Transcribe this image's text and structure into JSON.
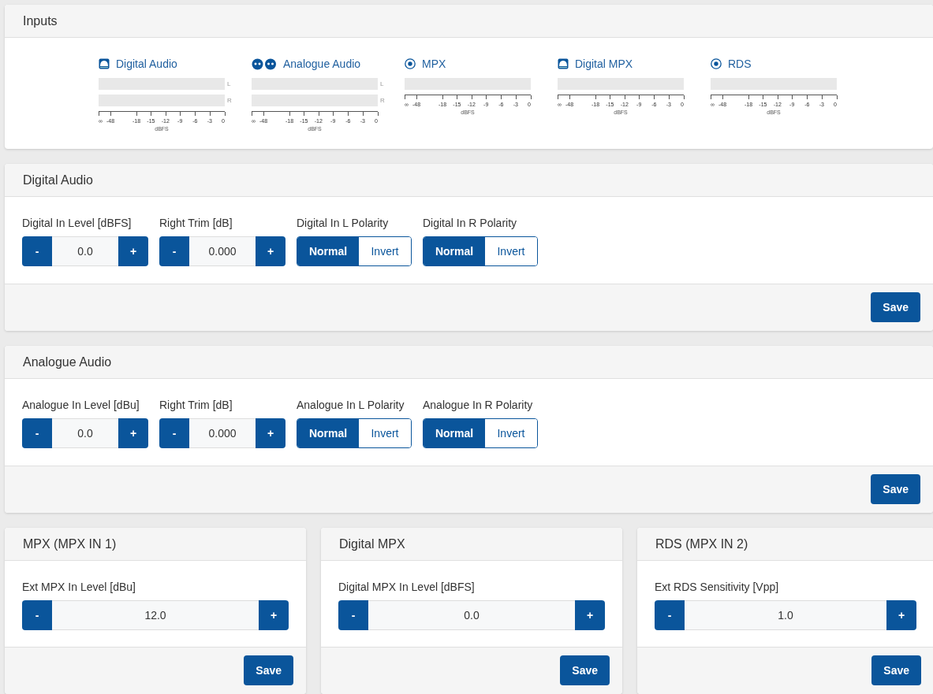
{
  "inputs": {
    "title": "Inputs",
    "meters": [
      {
        "kind": "digital",
        "label": "Digital Audio",
        "channels": [
          {
            "label": "L",
            "level": 0
          },
          {
            "label": "R",
            "level": 0
          }
        ],
        "scale": [
          "∞",
          "-48",
          "-18",
          "-15",
          "-12",
          "-9",
          "-6",
          "-3",
          "0"
        ],
        "unit": "dBFS"
      },
      {
        "kind": "analogue",
        "label": "Analogue Audio",
        "channels": [
          {
            "label": "L",
            "level": 0
          },
          {
            "label": "R",
            "level": 0
          }
        ],
        "scale": [
          "∞",
          "-48",
          "-18",
          "-15",
          "-12",
          "-9",
          "-6",
          "-3",
          "0"
        ],
        "unit": "dBFS"
      },
      {
        "kind": "mpx",
        "label": "MPX",
        "channels": [
          {
            "level": 0
          }
        ],
        "scale": [
          "∞",
          "-48",
          "-18",
          "-15",
          "-12",
          "-9",
          "-6",
          "-3",
          "0"
        ],
        "unit": "dBFS"
      },
      {
        "kind": "digital",
        "label": "Digital MPX",
        "channels": [
          {
            "level": 0
          }
        ],
        "scale": [
          "∞",
          "-48",
          "-18",
          "-15",
          "-12",
          "-9",
          "-6",
          "-3",
          "0"
        ],
        "unit": "dBFS"
      },
      {
        "kind": "mpx",
        "label": "RDS",
        "channels": [
          {
            "level": 0
          }
        ],
        "scale": [
          "∞",
          "-48",
          "-18",
          "-15",
          "-12",
          "-9",
          "-6",
          "-3",
          "0"
        ],
        "unit": "dBFS"
      }
    ]
  },
  "sections": [
    {
      "title": "Digital Audio",
      "controls": [
        {
          "kind": "stepper",
          "label": "Digital In Level [dBFS]",
          "minus": "-",
          "value": "0.0",
          "plus": "+"
        },
        {
          "kind": "stepper",
          "label": "Right Trim [dB]",
          "minus": "-",
          "value": "0.000",
          "plus": "+"
        },
        {
          "kind": "toggle",
          "label": "Digital In L Polarity",
          "options": [
            {
              "label": "Normal",
              "selected": true
            },
            {
              "label": "Invert",
              "selected": false
            }
          ]
        },
        {
          "kind": "toggle",
          "label": "Digital In R Polarity",
          "options": [
            {
              "label": "Normal",
              "selected": true
            },
            {
              "label": "Invert",
              "selected": false
            }
          ]
        }
      ],
      "save": "Save"
    },
    {
      "title": "Analogue Audio",
      "controls": [
        {
          "kind": "stepper",
          "label": "Analogue In Level [dBu]",
          "minus": "-",
          "value": "0.0",
          "plus": "+"
        },
        {
          "kind": "stepper",
          "label": "Right Trim [dB]",
          "minus": "-",
          "value": "0.000",
          "plus": "+"
        },
        {
          "kind": "toggle",
          "label": "Analogue In L Polarity",
          "options": [
            {
              "label": "Normal",
              "selected": true
            },
            {
              "label": "Invert",
              "selected": false
            }
          ]
        },
        {
          "kind": "toggle",
          "label": "Analogue In R Polarity",
          "options": [
            {
              "label": "Normal",
              "selected": true
            },
            {
              "label": "Invert",
              "selected": false
            }
          ]
        }
      ],
      "save": "Save"
    }
  ],
  "panels": [
    {
      "title": "MPX (MPX IN 1)",
      "controls": [
        {
          "kind": "stepper",
          "label": "Ext MPX In Level [dBu]",
          "minus": "-",
          "value": "12.0",
          "plus": "+"
        }
      ],
      "save": "Save"
    },
    {
      "title": "Digital MPX",
      "controls": [
        {
          "kind": "stepper",
          "label": "Digital MPX In Level [dBFS]",
          "minus": "-",
          "value": "0.0",
          "plus": "+"
        }
      ],
      "save": "Save"
    },
    {
      "title": "RDS (MPX IN 2)",
      "controls": [
        {
          "kind": "stepper",
          "label": "Ext RDS Sensitivity [Vpp]",
          "minus": "-",
          "value": "1.0",
          "plus": "+"
        }
      ],
      "save": "Save"
    }
  ]
}
